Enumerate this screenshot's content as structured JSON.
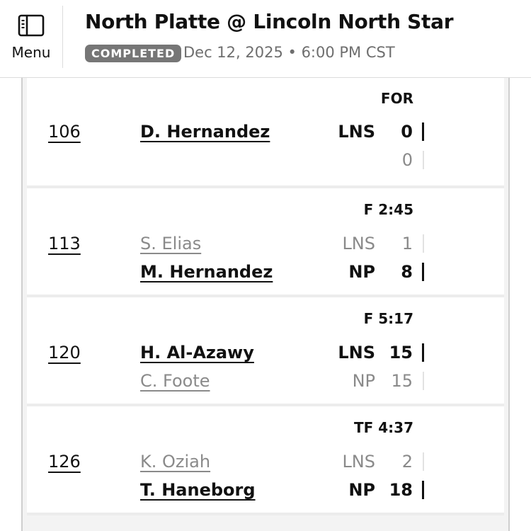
{
  "header": {
    "menu_label": "Menu",
    "title": "North Platte @ Lincoln North Star",
    "status": "COMPLETED",
    "date": "Dec 12, 2025 • 6:00 PM CST"
  },
  "bouts": [
    {
      "weight": "106",
      "result": "FOR",
      "top": {
        "name": "D. Hernandez",
        "team": "LNS",
        "score": "0",
        "winner": true
      },
      "bottom": {
        "name": "",
        "team": "",
        "score": "0",
        "winner": false
      }
    },
    {
      "weight": "113",
      "result": "F 2:45",
      "top": {
        "name": "S. Elias",
        "team": "LNS",
        "score": "1",
        "winner": false
      },
      "bottom": {
        "name": "M. Hernandez",
        "team": "NP",
        "score": "8",
        "winner": true
      }
    },
    {
      "weight": "120",
      "result": "F 5:17",
      "top": {
        "name": "H. Al-Azawy",
        "team": "LNS",
        "score": "15",
        "winner": true
      },
      "bottom": {
        "name": "C. Foote",
        "team": "NP",
        "score": "15",
        "winner": false
      }
    },
    {
      "weight": "126",
      "result": "TF 4:37",
      "top": {
        "name": "K. Oziah",
        "team": "LNS",
        "score": "2",
        "winner": false
      },
      "bottom": {
        "name": "T. Haneborg",
        "team": "NP",
        "score": "18",
        "winner": true
      }
    }
  ]
}
